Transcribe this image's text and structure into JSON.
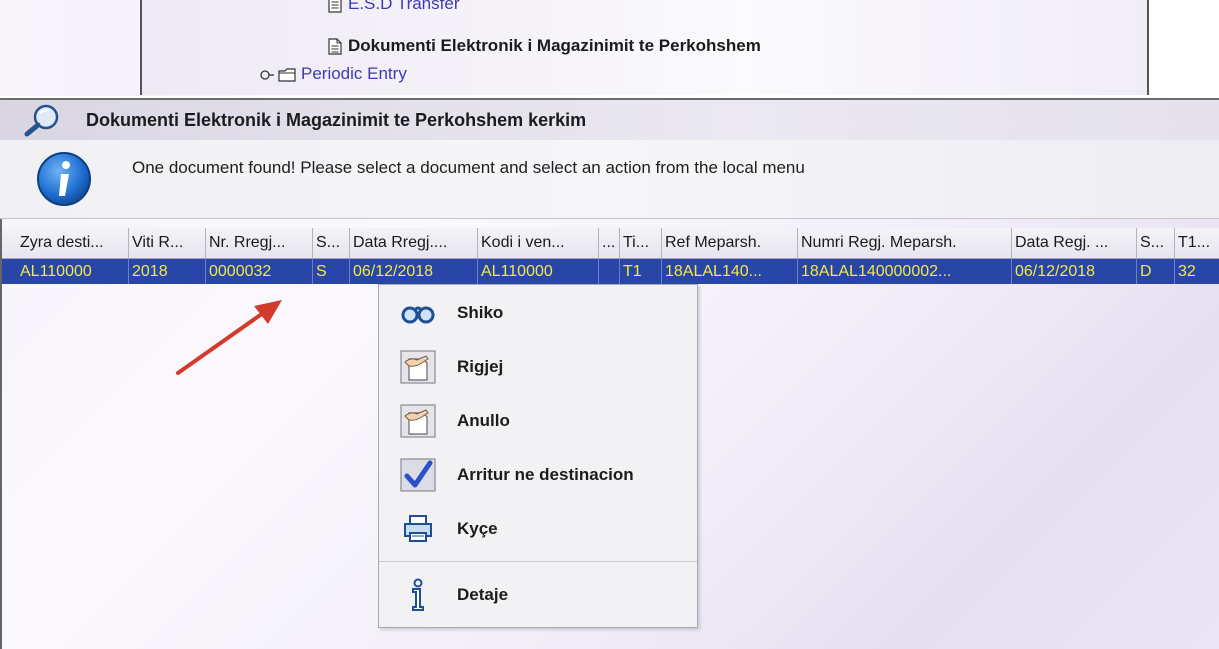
{
  "tree": {
    "items": [
      {
        "label": "E.S.D Transfer",
        "type": "document-link"
      },
      {
        "label": "Dokumenti Elektronik i Magazinimit te Perkohshem",
        "type": "document"
      },
      {
        "label": "Periodic Entry",
        "type": "folder"
      }
    ]
  },
  "search_title": "Dokumenti Elektronik i Magazinimit te Perkohshem kerkim",
  "info_message": "One document found! Please select a document and select an action from the local menu",
  "grid": {
    "columns": [
      "Zyra desti...",
      "Viti R...",
      "Nr. Rregj...",
      "S...",
      "Data Rregj....",
      "Kodi i ven...",
      "...",
      "Ti...",
      "Ref Meparsh.",
      "Numri Regj. Meparsh.",
      "Data Regj. ...",
      "S...",
      "T1..."
    ],
    "rows": [
      [
        "AL110000",
        "2018",
        "0000032",
        "S",
        "06/12/2018",
        "AL110000",
        "",
        "T1",
        "18ALAL140...",
        "18ALAL140000002...",
        "06/12/2018",
        "D",
        "32"
      ]
    ],
    "selected_row_bg": "#2846a8",
    "selected_row_text": "#f5e64a"
  },
  "context_menu": {
    "items": [
      {
        "label": "Shiko",
        "icon": "glasses-icon"
      },
      {
        "label": "Rigjej",
        "icon": "hand-document-icon"
      },
      {
        "label": "Anullo",
        "icon": "hand-document-icon"
      },
      {
        "label": "Arritur ne destinacion",
        "icon": "checkmark-icon"
      },
      {
        "label": "Kyçe",
        "icon": "printer-icon"
      },
      {
        "label": "Detaje",
        "icon": "info-icon"
      }
    ]
  },
  "colors": {
    "arrow": "#d23a2c",
    "link": "#3b3bb5",
    "info_icon_blue": "#1f6fd1"
  }
}
